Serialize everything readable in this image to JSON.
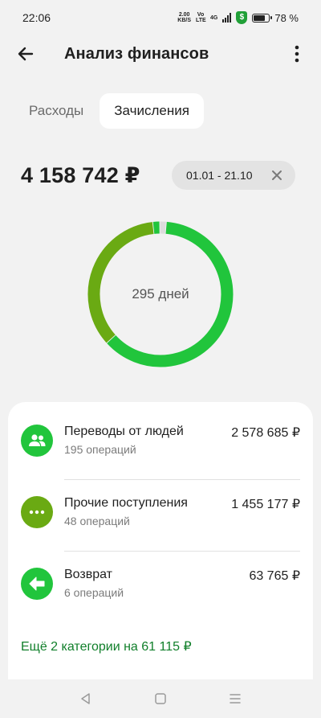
{
  "status_bar": {
    "time": "22:06",
    "net_speed": "2.00",
    "net_unit": "KB/S",
    "volte": "Vo LTE",
    "network": "4G",
    "battery": "78 %",
    "battery_level": 0.78
  },
  "header": {
    "back_icon": "arrow-left-icon",
    "title": "Анализ финансов",
    "menu_icon": "more-vertical-icon"
  },
  "tabs": [
    {
      "label": "Расходы",
      "active": false
    },
    {
      "label": "Зачисления",
      "active": true
    }
  ],
  "summary": {
    "total": "4 158 742 ₽",
    "date_range": "01.01 - 21.10",
    "close_icon": "close-icon"
  },
  "chart_data": {
    "type": "pie",
    "style": "donut",
    "center_label": "295 дней",
    "categories": [
      "Переводы от людей",
      "Прочие поступления",
      "Возврат",
      "Ещё 2 категории"
    ],
    "values": [
      2578685,
      1455177,
      63765,
      61115
    ],
    "colors": [
      "#21c53c",
      "#6aaa13",
      "#21c53c",
      "#dcdcdc"
    ]
  },
  "categories": [
    {
      "name": "Переводы от людей",
      "ops": "195 операций",
      "amount": "2 578 685 ₽",
      "icon": "people-icon",
      "color": "#21c53c"
    },
    {
      "name": "Прочие поступления",
      "ops": "48 операций",
      "amount": "1 455 177 ₽",
      "icon": "more-horizontal-icon",
      "color": "#6aaa13"
    },
    {
      "name": "Возврат",
      "ops": "6 операций",
      "amount": "63 765 ₽",
      "icon": "return-arrow-icon",
      "color": "#21c53c"
    }
  ],
  "more_categories": "Ещё 2 категории на 61 115 ₽",
  "nav": {
    "back": "nav-back-icon",
    "home": "nav-home-icon",
    "recents": "nav-menu-icon"
  }
}
